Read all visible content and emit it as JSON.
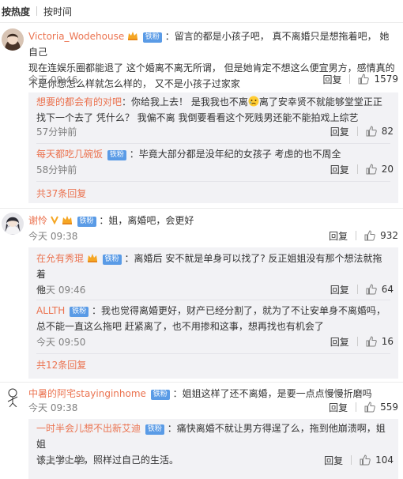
{
  "sort": {
    "hot": "按热度",
    "time": "按时间"
  },
  "actions": {
    "reply": "回复"
  },
  "c1": {
    "user": "Victoria_Wodehouse",
    "fan": "铁粉",
    "text1": "：留言的都是小孩子吧， 真不离婚只是想拖着吧， 她自己",
    "text2": "现在连娱乐圈都能退了 这个婚离不离无所谓， 但是她肯定不想这么便宜男方，感情真的",
    "text3": "不是你想怎么样就怎么样的， 又不是小孩子过家家",
    "time": "今天 09:46",
    "likes": "1579"
  },
  "c1r1": {
    "user": "想要的都会有的对吧",
    "text1a": "：你给我上去！ 是我我也不离",
    "text1b": "离了安幸贤不就能够堂堂正正",
    "text2": "找下一个去了 凭什么？ 我偏不离 我倒要看看这个死贱男还能不能拍戏上综艺",
    "time": "57分钟前",
    "likes": "82"
  },
  "c1r2": {
    "user": "每天都吃几碗饭",
    "fan": "铁粉",
    "text": "：毕竟大部分都是没年纪的女孩子 考虑的也不周全",
    "time": "58分钟前",
    "likes": "20"
  },
  "c1more": "共37条回复",
  "c2": {
    "user": "谢怜",
    "fan": "铁粉",
    "text": "：姐，离婚吧，会更好",
    "time": "今天 09:38",
    "likes": "932"
  },
  "c2r1": {
    "user": "在允有秀琨",
    "fan": "铁粉",
    "text1": "：离婚后 安不就是单身可以找了? 反正姐姐没有那个想法就拖着",
    "text2": "他",
    "time": "今天 09:46",
    "likes": "64"
  },
  "c2r2": {
    "user": "ALLTH",
    "fan": "铁粉",
    "text1": "：我也觉得离婚更好，财产已经分割了，就为了不让安单身不离婚吗，",
    "text2": "总不能一直这么拖吧 赶紧离了，也不用掺和这事，想再找也有机会了",
    "time": "今天 09:50",
    "likes": "16"
  },
  "c2more": "共12条回复",
  "c3": {
    "user": "中暑的阿宅stayinginhome",
    "fan": "铁粉",
    "text": "：姐姐这样了还不离婚，是要一点点慢慢折磨吗",
    "time": "今天 09:38",
    "likes": "559"
  },
  "c3r1": {
    "user": "一时半会儿想不出新艾迪",
    "fan": "铁粉",
    "text1": "：痛快离婚不就让男方得逞了么，拖到他崩溃啊，姐姐",
    "text2": "该上学上学，照样过自己的生活。",
    "time": "今天 09:43",
    "likes": "104"
  },
  "colors": {
    "accent": "#eb7350",
    "fan": "#5a9be6",
    "subbg": "#f2f2f5",
    "muted": "#808080"
  }
}
